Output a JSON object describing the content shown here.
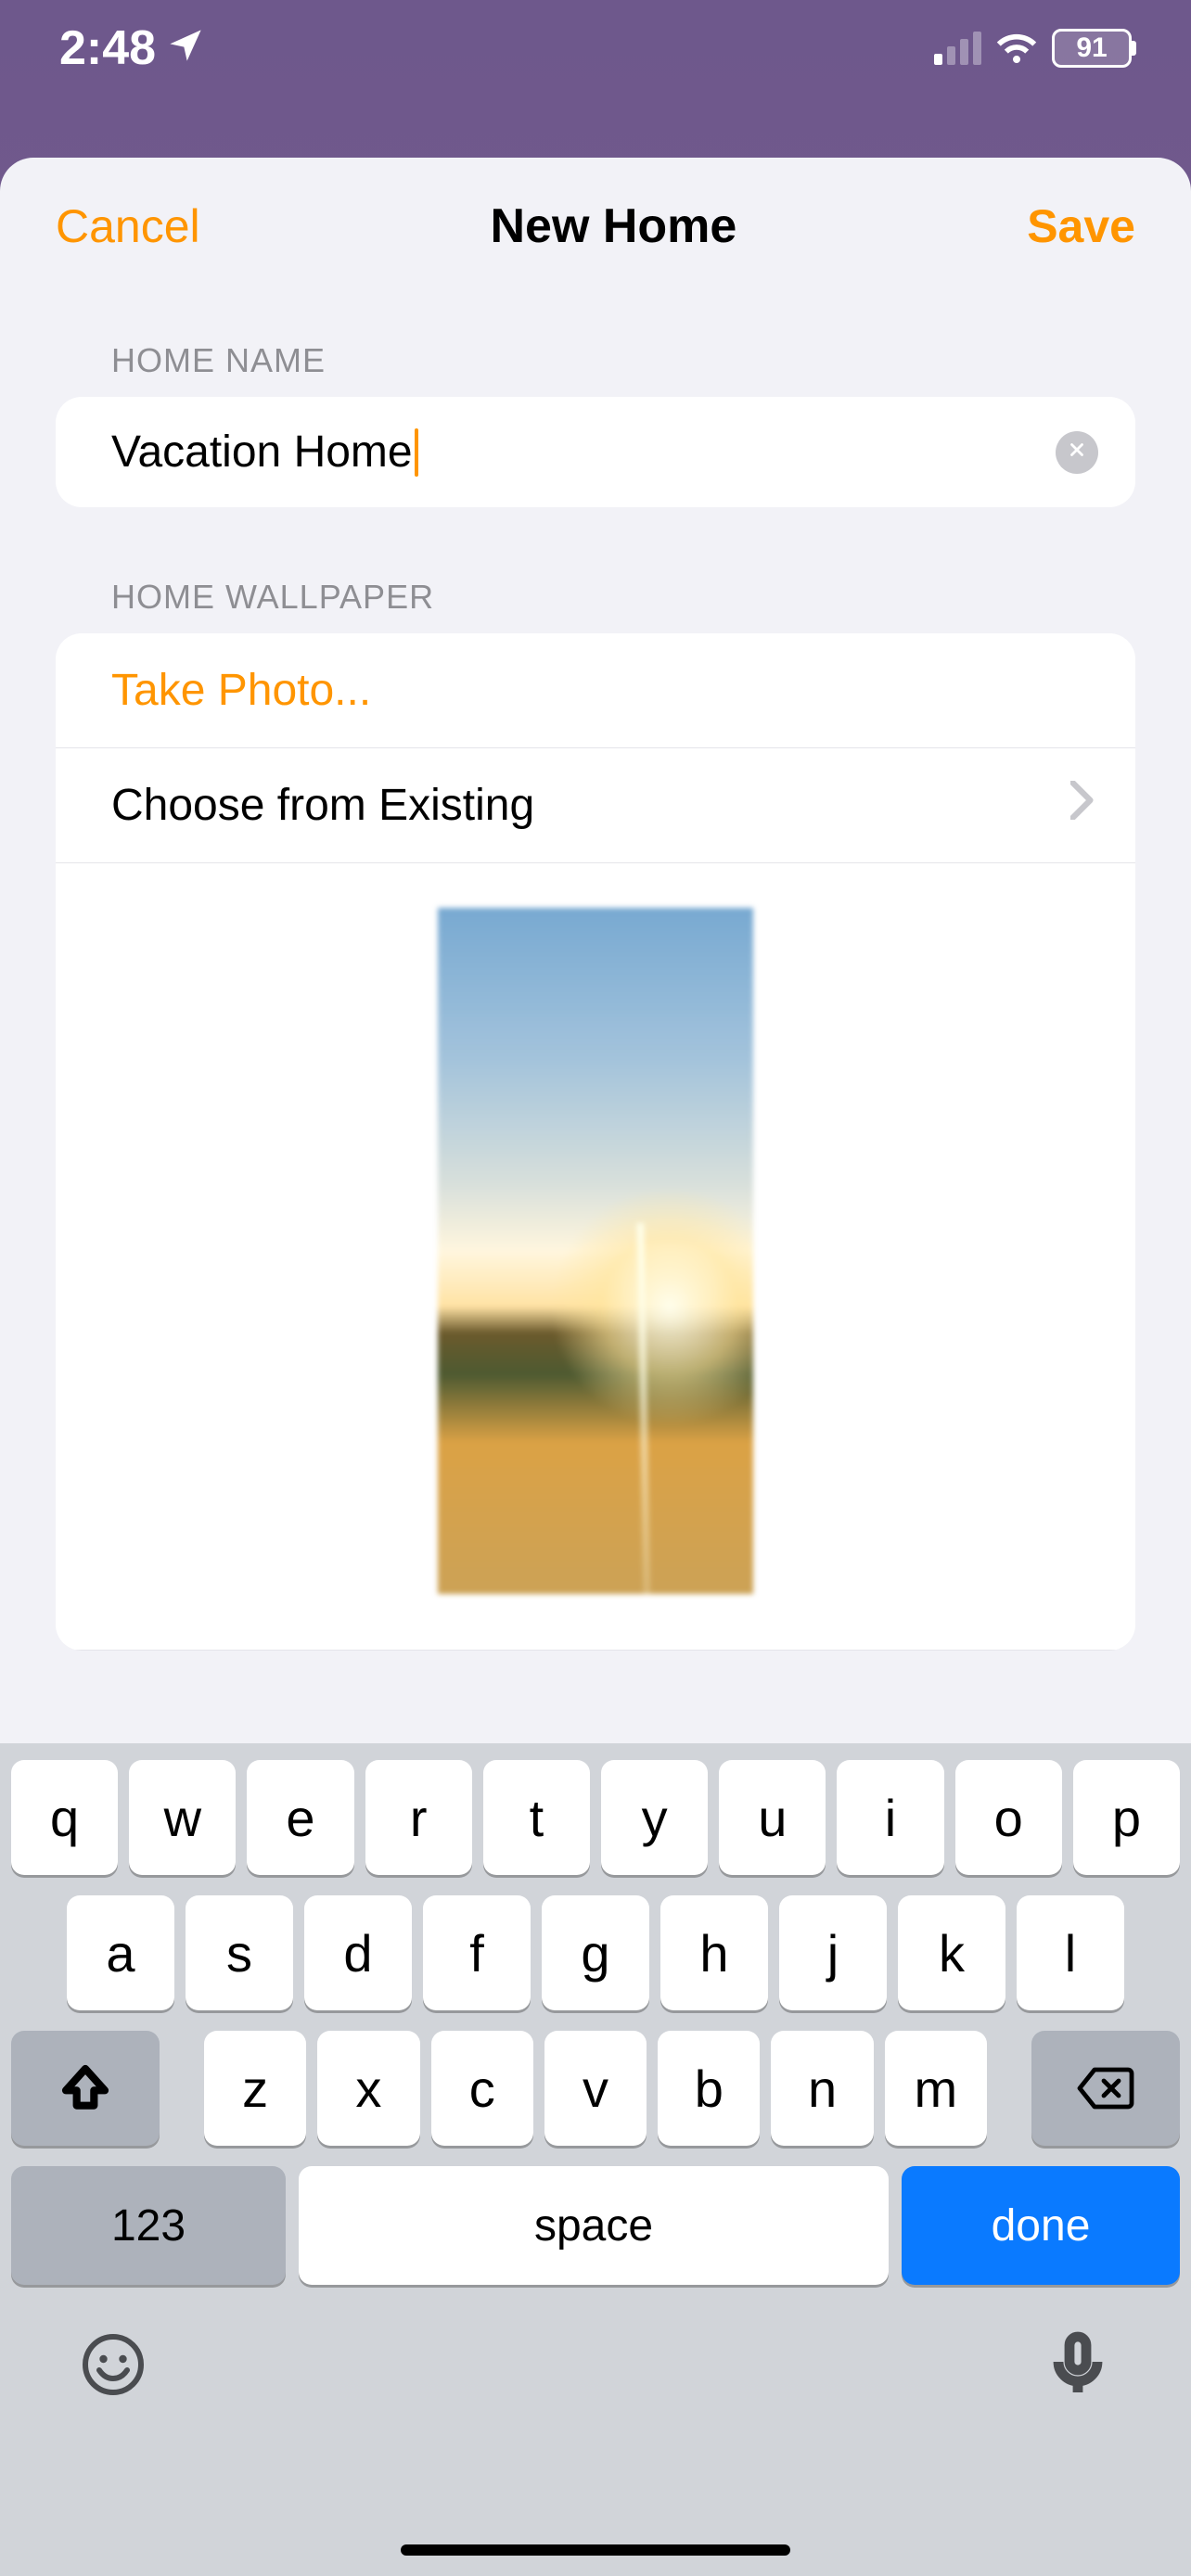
{
  "status": {
    "time": "2:48",
    "battery": "91"
  },
  "nav": {
    "cancel": "Cancel",
    "title": "New Home",
    "save": "Save"
  },
  "sections": {
    "name_label": "HOME NAME",
    "wallpaper_label": "HOME WALLPAPER"
  },
  "home_name": {
    "value": "Vacation Home"
  },
  "wallpaper": {
    "take_photo": "Take Photo...",
    "choose_existing": "Choose from Existing"
  },
  "keyboard": {
    "row1": [
      "q",
      "w",
      "e",
      "r",
      "t",
      "y",
      "u",
      "i",
      "o",
      "p"
    ],
    "row2": [
      "a",
      "s",
      "d",
      "f",
      "g",
      "h",
      "j",
      "k",
      "l"
    ],
    "row3": [
      "z",
      "x",
      "c",
      "v",
      "b",
      "n",
      "m"
    ],
    "switch": "123",
    "space": "space",
    "done": "done"
  }
}
